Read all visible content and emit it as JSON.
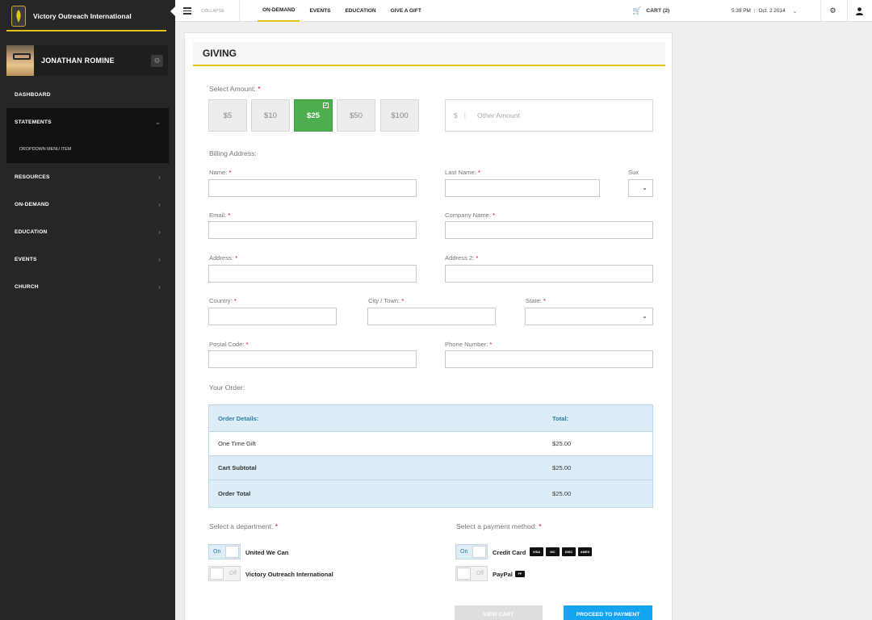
{
  "sidebar": {
    "brand": "Victory Outreach International",
    "user_name": "JONATHAN ROMINE",
    "items": [
      {
        "label": "DASHBOARD"
      },
      {
        "label": "STATEMENTS",
        "sub": "DROPDOWN MENU ITEM"
      },
      {
        "label": "RESOURCES"
      },
      {
        "label": "ON-DEMAND"
      },
      {
        "label": "EDUCATION"
      },
      {
        "label": "EVENTS"
      },
      {
        "label": "CHURCH"
      }
    ]
  },
  "topbar": {
    "collapse": "COLLAPSE",
    "tabs": [
      "ON-DEMAND",
      "EVENTS",
      "EDUCATION",
      "GIVE A GIFT"
    ],
    "cart": "CART (2)",
    "time": "5:39 PM",
    "date": "Oct. 2 2014",
    "accent": "#e2c318"
  },
  "giving": {
    "title": "GIVING",
    "select_amount": "Select Amount:",
    "amounts": [
      "$5",
      "$10",
      "$25",
      "$50",
      "$100"
    ],
    "selected_amount": "$25",
    "currency": "$",
    "other_placeholder": "Other Amount",
    "billing": "Billing Address:",
    "labels": {
      "name": "Name:",
      "last_name": "Last Name:",
      "sux": "Sux",
      "email": "Email:",
      "company": "Company Name:",
      "address": "Address:",
      "address2": "Address 2:",
      "country": "Country:",
      "city": "City / Town:",
      "state": "State:",
      "postal": "Postal Code:",
      "phone": "Phone Number:"
    },
    "your_order": "Your Order:",
    "order": {
      "header": [
        "Order Details:",
        "Total:"
      ],
      "rows": [
        {
          "label": "One Time Gift",
          "total": "$25.00"
        },
        {
          "label": "Cart Subtotal",
          "total": "$25.00"
        },
        {
          "label": "Order Total",
          "total": "$25.00"
        }
      ]
    },
    "department_label": "Select a department:",
    "departments": [
      {
        "label": "United We Can",
        "state": "On"
      },
      {
        "label": "Victory Outreach International",
        "state": "Off"
      }
    ],
    "payment_label": "Select a payment method:",
    "payments": [
      {
        "label": "Credit Card",
        "state": "On"
      },
      {
        "label": "PayPal",
        "state": "Off"
      }
    ],
    "card_brands": [
      "VISA",
      "MC",
      "DISC",
      "AMEX"
    ],
    "paypal_badge": "PP",
    "view_cart": "VIEW CART",
    "proceed": "PROCEED TO PAYMENT"
  }
}
